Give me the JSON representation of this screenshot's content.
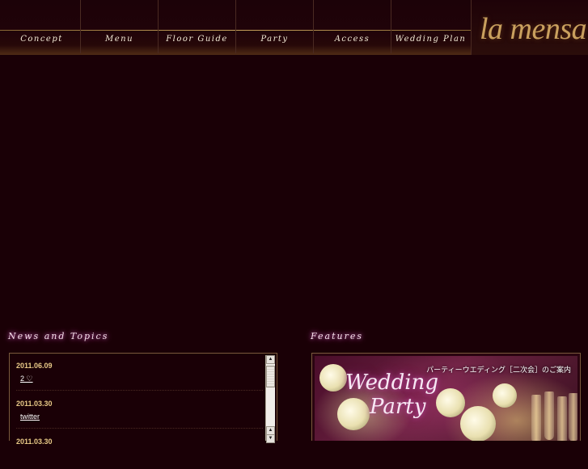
{
  "nav": {
    "items": [
      {
        "label": "Concept"
      },
      {
        "label": "Menu"
      },
      {
        "label": "Floor Guide"
      },
      {
        "label": "Party"
      },
      {
        "label": "Access"
      },
      {
        "label": "Wedding Plan"
      }
    ],
    "logo": "la mensa"
  },
  "news": {
    "title": "News and Topics",
    "items": [
      {
        "date": "2011.06.09",
        "link": "2 ♡"
      },
      {
        "date": "2011.03.30",
        "link": "twitter"
      },
      {
        "date": "2011.03.30",
        "link": ""
      }
    ],
    "scrollbar": {
      "up_arrow": "▲",
      "down_arrow": "▼"
    }
  },
  "features": {
    "title": "Features",
    "banner": {
      "caption": "パーティーウエディング［二次会］のご案内",
      "script_line1": "Wedding",
      "script_line2": "Party"
    }
  },
  "colors": {
    "background": "#1a0006",
    "nav_text": "#f3ead6",
    "logo": "#c9a05e",
    "date_text": "#e8c987",
    "section_glow": "#d05ab8",
    "frame_border": "#7a5a3c"
  }
}
